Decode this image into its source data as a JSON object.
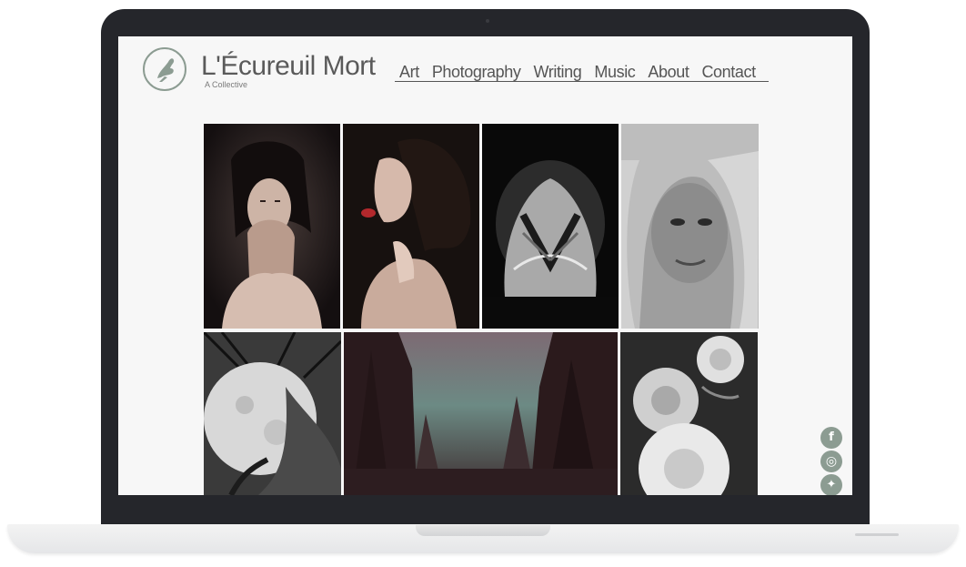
{
  "site": {
    "title": "L'Écureuil Mort",
    "tagline": "A Collective"
  },
  "nav": {
    "items": [
      {
        "label": "Art"
      },
      {
        "label": "Photography"
      },
      {
        "label": "Writing"
      },
      {
        "label": "Music"
      },
      {
        "label": "About"
      },
      {
        "label": "Contact"
      }
    ]
  },
  "gallery": {
    "images": [
      {
        "subject": "portrait-hands-to-mouth"
      },
      {
        "subject": "profile-red-lips"
      },
      {
        "subject": "hands-over-face"
      },
      {
        "subject": "blonde-hair-portrait"
      },
      {
        "subject": "moon-and-branches"
      },
      {
        "subject": "misty-pine-forest"
      },
      {
        "subject": "white-roses"
      }
    ]
  },
  "social": [
    {
      "icon": "facebook-icon",
      "glyph": "f"
    },
    {
      "icon": "instagram-icon",
      "glyph": "◎"
    },
    {
      "icon": "twitter-icon",
      "glyph": "✦"
    }
  ],
  "colors": {
    "accent": "#8c9c92",
    "frame": "#25262b",
    "screen_bg": "#f7f7f7",
    "text": "#555555"
  }
}
